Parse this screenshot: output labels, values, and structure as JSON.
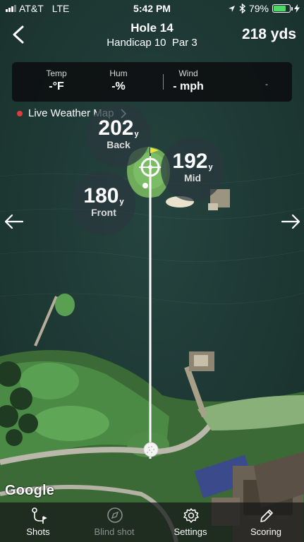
{
  "status_bar": {
    "carrier": "AT&T",
    "network": "LTE",
    "time": "5:42 PM",
    "battery": "79%",
    "battery_level": 0.79,
    "icons": [
      "signal-icon",
      "location-arrow-icon",
      "bluetooth-icon",
      "battery-icon",
      "charging-icon"
    ]
  },
  "header": {
    "title": "Hole 14",
    "subtitle": "Handicap 10  Par 3",
    "total_distance": "218 yds",
    "back_icon": "back-chevron-icon"
  },
  "weather": {
    "temp_label": "Temp",
    "temp_value": "-°F",
    "hum_label": "Hum",
    "hum_value": "-%",
    "wind_label": "Wind",
    "wind_value": "- mph",
    "extra": "-"
  },
  "live_map": {
    "label": "Live Weather Map",
    "dot_color": "#e23b3b"
  },
  "yardages": {
    "back": {
      "value": "202",
      "unit": "y",
      "label": "Back"
    },
    "mid": {
      "value": "192",
      "unit": "y",
      "label": "Mid"
    },
    "front": {
      "value": "180",
      "unit": "y",
      "label": "Front"
    }
  },
  "map": {
    "attribution": "Google",
    "flag_color": "#f2e33a"
  },
  "bottom_nav": {
    "items": [
      {
        "label": "Shots",
        "icon": "shot-path-icon",
        "enabled": true
      },
      {
        "label": "Blind shot",
        "icon": "compass-icon",
        "enabled": false
      },
      {
        "label": "Settings",
        "icon": "gear-icon",
        "enabled": true
      },
      {
        "label": "Scoring",
        "icon": "pencil-icon",
        "enabled": true
      }
    ]
  }
}
